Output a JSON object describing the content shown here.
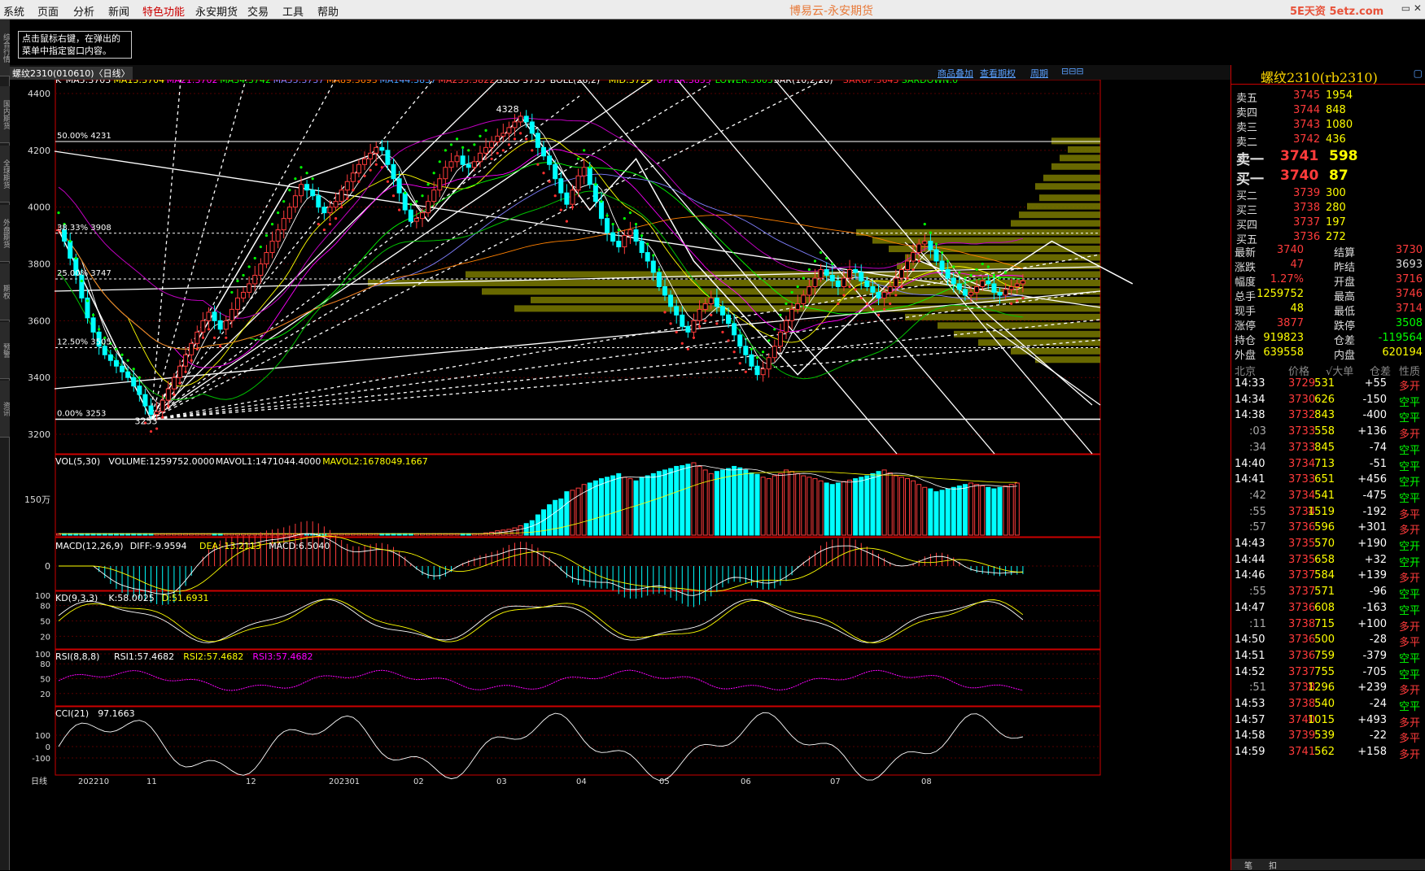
{
  "menu": {
    "items": [
      "系统",
      "页面",
      "分析",
      "新闻",
      "特色功能",
      "永安期货",
      "交易",
      "工具",
      "帮助"
    ],
    "active": "特色功能"
  },
  "window_title": "博易云-永安期货",
  "brand": "5E天资 5etz.com",
  "tip": {
    "line1": "点击鼠标右键，在弹出的",
    "line2": "菜单中指定窗口内容。"
  },
  "left_tabs": [
    "综合行情",
    "国内期货",
    "全球期货",
    "外盘期货",
    "期权",
    "预警",
    "资讯"
  ],
  "tabstrip": {
    "code": "螺纹2310(010610)〈日线〉",
    "links": [
      "商品叠加",
      "查看期权",
      "周期"
    ]
  },
  "colors": {
    "up": "#ff3b3b",
    "down": "#00ffff",
    "yellow": "#ffff00",
    "green": "#00ff00",
    "white": "#ffffff",
    "magenta": "#ff00ff",
    "olive": "#808000"
  },
  "main_header": [
    {
      "t": "K",
      "c": "#ffffff"
    },
    {
      "t": "MA5:3703",
      "c": "#ffffff"
    },
    {
      "t": "MA13:3704",
      "c": "#ffff00"
    },
    {
      "t": "MA21:3702",
      "c": "#ff00ff"
    },
    {
      "t": "MA34:3742",
      "c": "#00ff00"
    },
    {
      "t": "MA55:3737",
      "c": "#8080ff"
    },
    {
      "t": "MA89:3693",
      "c": "#ff8000"
    },
    {
      "t": "MA144:3837",
      "c": "#40a0ff"
    },
    {
      "t": "MA233:3822",
      "c": "#ff4040"
    },
    {
      "t": "SSLO 3735",
      "c": "#ffffff"
    },
    {
      "t": "BOLL(26,2)",
      "c": "#ffffff"
    },
    {
      "t": "MID:3729",
      "c": "#ffff00"
    },
    {
      "t": "UPPER:3855",
      "c": "#ff00ff"
    },
    {
      "t": "LOWER:3603",
      "c": "#00ff00"
    },
    {
      "t": "SAR(10,2,20)",
      "c": "#ffffff"
    },
    {
      "t": "SARUP:3643",
      "c": "#ff3030"
    },
    {
      "t": "SARDOWN:0",
      "c": "#00ff00"
    }
  ],
  "price_axis": [
    "4400",
    "4200",
    "4000",
    "3800",
    "3600",
    "3400",
    "3200"
  ],
  "fib": [
    {
      "label": "50.00%  4231"
    },
    {
      "label": "38.33%  3908"
    },
    {
      "label": "25.00%  3747"
    },
    {
      "label": "12.50%  3505"
    },
    {
      "label": "0.00%  3253"
    }
  ],
  "price_marks": {
    "high": "4328",
    "low": "3253",
    "low_label": "3253"
  },
  "vol": {
    "header": [
      {
        "t": "VOL(5,30)",
        "c": "#ffffff"
      },
      {
        "t": "VOLUME:1259752.0000",
        "c": "#ffffff"
      },
      {
        "t": "MAVOL1:1471044.4000",
        "c": "#ffffff"
      },
      {
        "t": "MAVOL2:1678049.1667",
        "c": "#ffff00"
      }
    ],
    "axis": "150万"
  },
  "macd": {
    "header": [
      {
        "t": "MACD(12,26,9)",
        "c": "#ffffff"
      },
      {
        "t": "DIFF:-9.9594",
        "c": "#ffffff"
      },
      {
        "t": "DEA:-13.2113",
        "c": "#ffff00"
      },
      {
        "t": "MACD:6.5040",
        "c": "#ffffff"
      }
    ],
    "axis": "0"
  },
  "kd": {
    "header": [
      {
        "t": "KD(9,3,3)",
        "c": "#ffffff"
      },
      {
        "t": "K:58.0025",
        "c": "#ffffff"
      },
      {
        "t": "D:51.6931",
        "c": "#ffff00"
      }
    ],
    "axis": [
      "100",
      "80",
      "50",
      "20"
    ]
  },
  "rsi": {
    "header": [
      {
        "t": "RSI(8,8,8)",
        "c": "#ffffff"
      },
      {
        "t": "RSI1:57.4682",
        "c": "#ffffff"
      },
      {
        "t": "RSI2:57.4682",
        "c": "#ffff00"
      },
      {
        "t": "RSI3:57.4682",
        "c": "#ff00ff"
      }
    ],
    "axis": [
      "100",
      "80",
      "50",
      "20"
    ]
  },
  "cci": {
    "header": [
      {
        "t": "CCI(21)",
        "c": "#ffffff"
      },
      {
        "t": "97.1663",
        "c": "#ffffff"
      }
    ],
    "axis": [
      "100",
      "0",
      "-100"
    ]
  },
  "date_axis": [
    "日线",
    "202210",
    "11",
    "12",
    "202301",
    "02",
    "03",
    "04",
    "05",
    "06",
    "07",
    "08"
  ],
  "quote": {
    "title": "螺纹2310(rb2310)",
    "asks": [
      [
        "卖五",
        "3745",
        "1954"
      ],
      [
        "卖四",
        "3744",
        "848"
      ],
      [
        "卖三",
        "3743",
        "1080"
      ],
      [
        "卖二",
        "3742",
        "436"
      ],
      [
        "卖一",
        "3741",
        "598"
      ]
    ],
    "bids": [
      [
        "买一",
        "3740",
        "87"
      ],
      [
        "买二",
        "3739",
        "300"
      ],
      [
        "买三",
        "3738",
        "280"
      ],
      [
        "买四",
        "3737",
        "197"
      ],
      [
        "买五",
        "3736",
        "272"
      ]
    ],
    "stats": [
      [
        "最新",
        "3740",
        "结算",
        "3730"
      ],
      [
        "涨跌",
        "47",
        "昨结",
        "3693"
      ],
      [
        "幅度",
        "1.27%",
        "开盘",
        "3716"
      ],
      [
        "总手",
        "1259752",
        "最高",
        "3746"
      ],
      [
        "现手",
        "48",
        "最低",
        "3714"
      ],
      [
        "涨停",
        "3877",
        "跌停",
        "3508"
      ],
      [
        "持仓",
        "919823",
        "仓差",
        "-119564"
      ],
      [
        "外盘",
        "639558",
        "内盘",
        "620194"
      ]
    ],
    "ticks_header": [
      "北京",
      "价格",
      "√大单",
      "仓差",
      "性质"
    ],
    "ticks": [
      [
        "14:33",
        "3729",
        "531",
        "+55",
        "多开"
      ],
      [
        "14:34",
        "3730",
        "626",
        "-150",
        "空平"
      ],
      [
        "14:38",
        "3732",
        "843",
        "-400",
        "空平"
      ],
      [
        ":03",
        "3733",
        "558",
        "+136",
        "多开"
      ],
      [
        ":34",
        "3733",
        "845",
        "-74",
        "空平"
      ],
      [
        "14:40",
        "3734",
        "713",
        "-51",
        "空平"
      ],
      [
        "14:41",
        "3733",
        "651",
        "+456",
        "空开"
      ],
      [
        ":42",
        "3734",
        "541",
        "-475",
        "空平"
      ],
      [
        ":55",
        "3734",
        "1519",
        "-192",
        "多平"
      ],
      [
        ":57",
        "3736",
        "596",
        "+301",
        "多开"
      ],
      [
        "14:43",
        "3735",
        "570",
        "+190",
        "空开"
      ],
      [
        "14:44",
        "3735",
        "658",
        "+32",
        "空开"
      ],
      [
        "14:46",
        "3737",
        "584",
        "+139",
        "多开"
      ],
      [
        ":55",
        "3737",
        "571",
        "-96",
        "空平"
      ],
      [
        "14:47",
        "3736",
        "608",
        "-163",
        "空平"
      ],
      [
        ":11",
        "3738",
        "715",
        "+100",
        "多开"
      ],
      [
        "14:50",
        "3736",
        "500",
        "-28",
        "多平"
      ],
      [
        "14:51",
        "3736",
        "759",
        "-379",
        "空平"
      ],
      [
        "14:52",
        "3737",
        "755",
        "-705",
        "空平"
      ],
      [
        ":51",
        "3738",
        "1296",
        "+239",
        "多开"
      ],
      [
        "14:53",
        "3738",
        "540",
        "-24",
        "空平"
      ],
      [
        "14:57",
        "3740",
        "1015",
        "+493",
        "多开"
      ],
      [
        "14:58",
        "3739",
        "539",
        "-22",
        "多平"
      ],
      [
        "14:59",
        "3741",
        "562",
        "+158",
        "多开"
      ]
    ],
    "bottom_tabs": [
      "笔",
      "扣"
    ]
  },
  "chart_data": {
    "type": "candlestick",
    "title": "螺纹2310(010610) 日线",
    "x_range": [
      "202210",
      "08"
    ],
    "ylim": [
      3160,
      4420
    ],
    "high": 4328,
    "low": 3253,
    "fib_levels": [
      4231,
      3908,
      3747,
      3505,
      3253
    ],
    "ma_last": {
      "MA5": 3703,
      "MA13": 3704,
      "MA21": 3702,
      "MA34": 3742,
      "MA55": 3737,
      "MA89": 3693,
      "MA144": 3837,
      "MA233": 3822
    },
    "boll": {
      "mid": 3729,
      "upper": 3855,
      "lower": 3603
    },
    "close_path": [
      3920,
      3880,
      3820,
      3760,
      3680,
      3610,
      3560,
      3510,
      3480,
      3460,
      3440,
      3420,
      3400,
      3370,
      3340,
      3300,
      3270,
      3280,
      3320,
      3360,
      3400,
      3440,
      3480,
      3520,
      3560,
      3600,
      3630,
      3600,
      3570,
      3600,
      3640,
      3680,
      3700,
      3730,
      3760,
      3800,
      3840,
      3880,
      3920,
      3960,
      4000,
      4040,
      4080,
      4060,
      4040,
      4000,
      3980,
      4000,
      4020,
      4060,
      4090,
      4120,
      4150,
      4170,
      4190,
      4210,
      4200,
      4150,
      4100,
      4050,
      3990,
      3950,
      3960,
      3980,
      4020,
      4060,
      4100,
      4140,
      4160,
      4180,
      4150,
      4140,
      4160,
      4190,
      4210,
      4230,
      4250,
      4260,
      4280,
      4300,
      4320,
      4300,
      4260,
      4210,
      4180,
      4150,
      4100,
      4050,
      4010,
      4060,
      4110,
      4140,
      4080,
      4020,
      3960,
      3910,
      3880,
      3860,
      3900,
      3920,
      3880,
      3840,
      3810,
      3770,
      3720,
      3690,
      3650,
      3620,
      3580,
      3560,
      3600,
      3640,
      3660,
      3680,
      3650,
      3620,
      3590,
      3550,
      3510,
      3480,
      3440,
      3410,
      3430,
      3470,
      3510,
      3560,
      3600,
      3640,
      3660,
      3690,
      3720,
      3750,
      3780,
      3760,
      3740,
      3720,
      3750,
      3780,
      3770,
      3740,
      3720,
      3700,
      3680,
      3700,
      3720,
      3750,
      3780,
      3810,
      3840,
      3870,
      3880,
      3850,
      3810,
      3780,
      3750,
      3730,
      3710,
      3690,
      3700,
      3720,
      3740,
      3730,
      3700,
      3690,
      3710,
      3720,
      3730,
      3740
    ],
    "volume_ratio": [
      0.02,
      0.02,
      0.02,
      0.02,
      0.02,
      0.02,
      0.02,
      0.02,
      0.02,
      0.02,
      0.02,
      0.02,
      0.02,
      0.02,
      0.02,
      0.02,
      0.02,
      0.02,
      0.02,
      0.02,
      0.02,
      0.02,
      0.02,
      0.02,
      0.02,
      0.02,
      0.02,
      0.02,
      0.02,
      0.02,
      0.02,
      0.02,
      0.02,
      0.02,
      0.02,
      0.02,
      0.02,
      0.02,
      0.02,
      0.02,
      0.02,
      0.02,
      0.02,
      0.02,
      0.02,
      0.02,
      0.02,
      0.02,
      0.02,
      0.02,
      0.02,
      0.02,
      0.02,
      0.02,
      0.02,
      0.02,
      0.02,
      0.02,
      0.02,
      0.02,
      0.02,
      0.02,
      0.02,
      0.02,
      0.02,
      0.02,
      0.02,
      0.02,
      0.02,
      0.02,
      0.02,
      0.02,
      0.02,
      0.02,
      0.03,
      0.04,
      0.06,
      0.07,
      0.08,
      0.1,
      0.13,
      0.16,
      0.2,
      0.28,
      0.35,
      0.42,
      0.48,
      0.5,
      0.6,
      0.62,
      0.65,
      0.7,
      0.72,
      0.75,
      0.78,
      0.8,
      0.82,
      0.85,
      0.8,
      0.78,
      0.75,
      0.8,
      0.82,
      0.85,
      0.88,
      0.9,
      0.92,
      0.95,
      0.96,
      0.98,
      1.0,
      0.95,
      0.9,
      0.85,
      0.88,
      0.9,
      0.92,
      0.95,
      0.93,
      0.9,
      0.86,
      0.84,
      0.8,
      0.78,
      0.82,
      0.85,
      0.9,
      0.88,
      0.85,
      0.82,
      0.8,
      0.78,
      0.75,
      0.72,
      0.7,
      0.72,
      0.74,
      0.76,
      0.78,
      0.8,
      0.82,
      0.85,
      0.88,
      0.9,
      0.86,
      0.82,
      0.8,
      0.78,
      0.75,
      0.7,
      0.66,
      0.64,
      0.6,
      0.62,
      0.64,
      0.66,
      0.68,
      0.7,
      0.72,
      0.7,
      0.68,
      0.66,
      0.64,
      0.66,
      0.68,
      0.7,
      0.72
    ]
  }
}
